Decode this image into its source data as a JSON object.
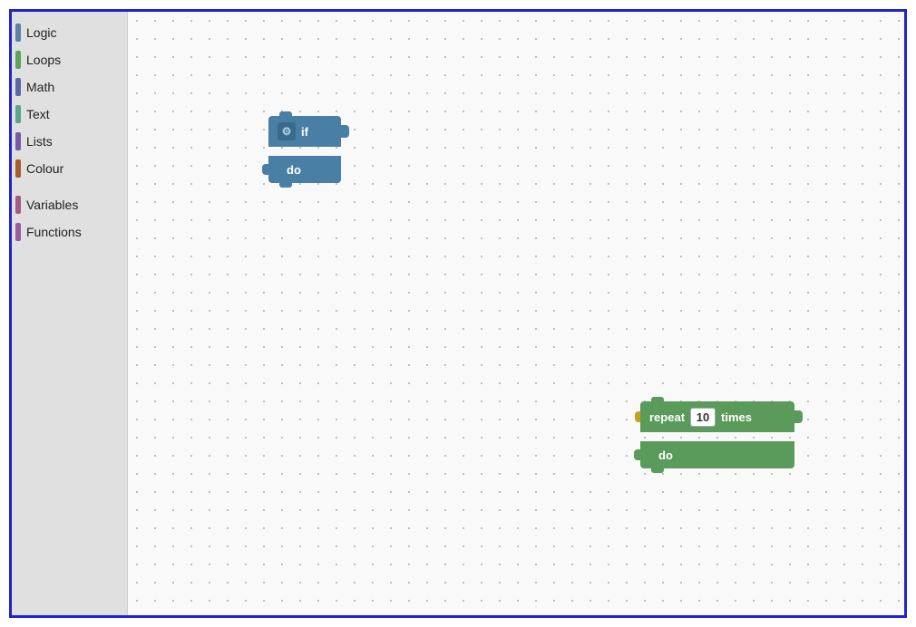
{
  "sidebar": {
    "items": [
      {
        "id": "logic",
        "label": "Logic",
        "color": "#5b80a5"
      },
      {
        "id": "loops",
        "label": "Loops",
        "color": "#5ba55b"
      },
      {
        "id": "math",
        "label": "Math",
        "color": "#5b67a5"
      },
      {
        "id": "text",
        "label": "Text",
        "color": "#5ba58c"
      },
      {
        "id": "lists",
        "label": "Lists",
        "color": "#745ba5"
      },
      {
        "id": "colour",
        "label": "Colour",
        "color": "#a55b2a"
      },
      {
        "id": "variables",
        "label": "Variables",
        "color": "#a55b80"
      },
      {
        "id": "functions",
        "label": "Functions",
        "color": "#9a5ba5"
      }
    ]
  },
  "blocks": {
    "if_block": {
      "top_label": "if",
      "bottom_label": "do",
      "gear_icon": "⚙"
    },
    "repeat_block": {
      "repeat_label": "repeat",
      "number": "10",
      "times_label": "times",
      "do_label": "do"
    }
  }
}
